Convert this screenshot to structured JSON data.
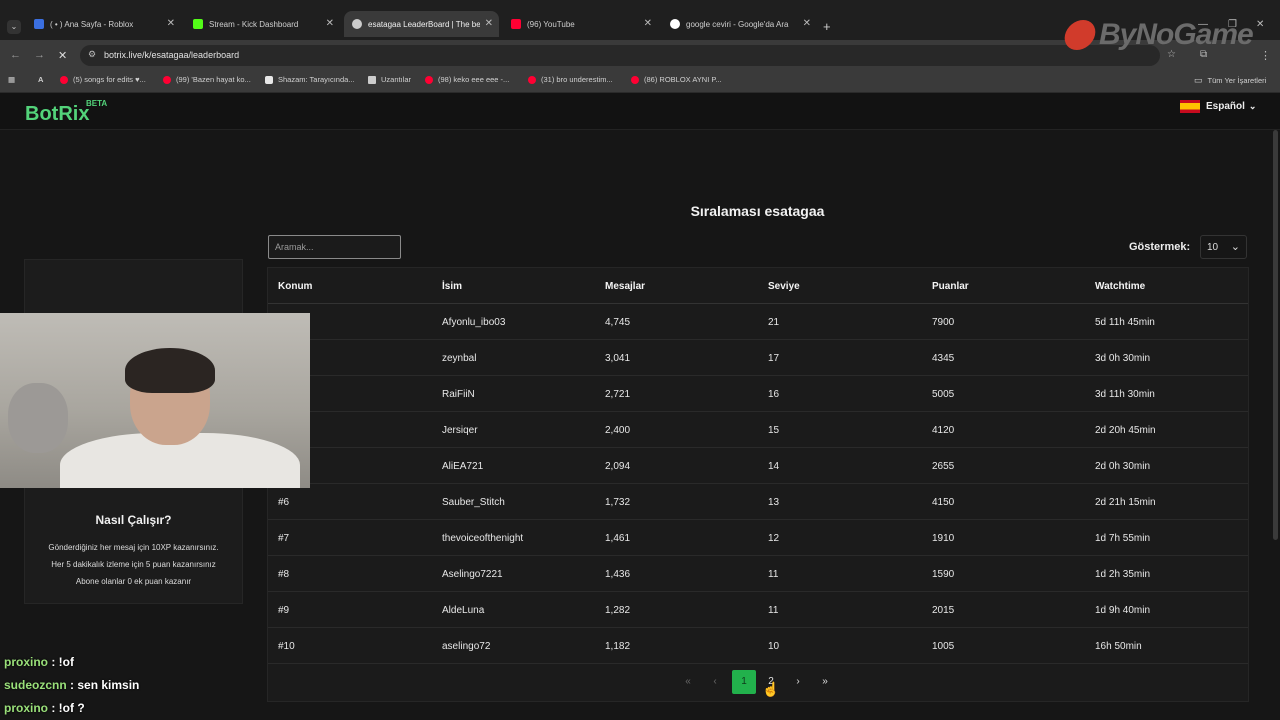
{
  "browser": {
    "tabs": [
      {
        "label": "( • ) Ana Sayfa - Roblox",
        "favicon_color": "#3b6fe0"
      },
      {
        "label": "Stream - Kick Dashboard",
        "favicon_color": "#53fc18"
      },
      {
        "label": "esatagaa LeaderBoard | The be",
        "favicon_color": "#cccccc"
      },
      {
        "label": "(96) YouTube",
        "favicon_color": "#ff0033"
      },
      {
        "label": "google ceviri - Google'da Ara",
        "favicon_color": "#ffffff"
      }
    ],
    "new_tab": "+",
    "url": "botrix.live/k/esatagaa/leaderboard",
    "bookmarks": [
      {
        "label": "(5) songs for edits ♥...",
        "icon_color": "#ff0033"
      },
      {
        "label": "(99) 'Bazen hayat ko...",
        "icon_color": "#ff0033"
      },
      {
        "label": "Shazam: Tarayıcında...",
        "icon_color": "#e8e8e8"
      },
      {
        "label": "Uzantılar",
        "icon_color": "#cccccc"
      },
      {
        "label": "(98) keko eee eee -...",
        "icon_color": "#ff0033"
      },
      {
        "label": "(31) bro underestim...",
        "icon_color": "#ff0033"
      },
      {
        "label": "(86) ROBLOX AYNI P...",
        "icon_color": "#ff0033"
      }
    ],
    "all_bookmarks": "Tüm Yer İşaretleri"
  },
  "watermark": "ByNoGame",
  "site": {
    "brand": "BotRix",
    "beta": "BETA",
    "language": "Español"
  },
  "leaderboard": {
    "title": "Sıralaması esatagaa",
    "search_placeholder": "Aramak...",
    "show_label": "Göstermek:",
    "show_value": "10",
    "columns": [
      "Konum",
      "İsim",
      "Mesajlar",
      "Seviye",
      "Puanlar",
      "Watchtime"
    ],
    "rows": [
      [
        "",
        "Afyonlu_ibo03",
        "4,745",
        "21",
        "7900",
        "5d 11h 45min"
      ],
      [
        "",
        "zeynbal",
        "3,041",
        "17",
        "4345",
        "3d 0h 30min"
      ],
      [
        "",
        "RaiFiiN",
        "2,721",
        "16",
        "5005",
        "3d 11h 30min"
      ],
      [
        "",
        "Jersiqer",
        "2,400",
        "15",
        "4120",
        "2d 20h 45min"
      ],
      [
        "",
        "AliEA721",
        "2,094",
        "14",
        "2655",
        "2d 0h 30min"
      ],
      [
        "#6",
        "Sauber_Stitch",
        "1,732",
        "13",
        "4150",
        "2d 21h 15min"
      ],
      [
        "#7",
        "thevoiceofthenight",
        "1,461",
        "12",
        "1910",
        "1d 7h 55min"
      ],
      [
        "#8",
        "Aselingo7221",
        "1,436",
        "11",
        "1590",
        "1d 2h 35min"
      ],
      [
        "#9",
        "AldeLuna",
        "1,282",
        "11",
        "2015",
        "1d 9h 40min"
      ],
      [
        "#10",
        "aselingo72",
        "1,182",
        "10",
        "1005",
        "16h 50min"
      ]
    ],
    "pager": {
      "first": "«",
      "prev": "‹",
      "pages": [
        "1",
        "2"
      ],
      "current": "1",
      "next": "›",
      "last": "»"
    }
  },
  "how": {
    "title": "Nasıl Çalışır?",
    "lines": [
      "Gönderdiğiniz her mesaj için 10XP kazanırsınız.",
      "Her 5 dakikalık izleme için 5 puan kazanırsınız",
      "Abone olanlar 0 ek puan kazanır"
    ]
  },
  "chat": [
    {
      "user": "proxino",
      "message": "!of"
    },
    {
      "user": "sudeozcnn",
      "message": "sen kimsin"
    },
    {
      "user": "proxino",
      "message": "!of ?"
    }
  ]
}
